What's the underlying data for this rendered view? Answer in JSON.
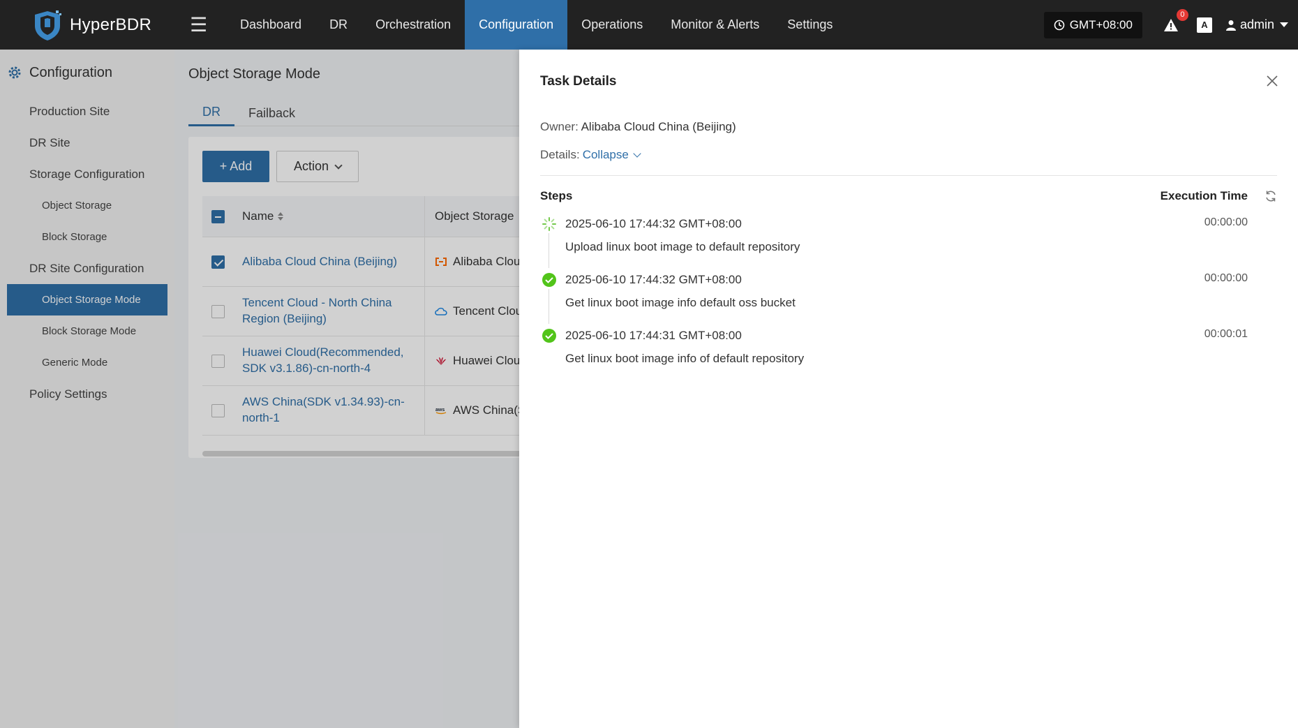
{
  "app": {
    "name": "HyperBDR"
  },
  "nav": {
    "items": [
      "Dashboard",
      "DR",
      "Orchestration",
      "Configuration",
      "Operations",
      "Monitor & Alerts",
      "Settings"
    ],
    "active": "Configuration"
  },
  "topbar": {
    "timezone": "GMT+08:00",
    "alert_count": "0",
    "lang_glyph": "A",
    "user": "admin"
  },
  "sidebar": {
    "title": "Configuration",
    "items": [
      {
        "label": "Production Site"
      },
      {
        "label": "DR Site"
      },
      {
        "label": "Storage Configuration"
      },
      {
        "label": "Object Storage"
      },
      {
        "label": "Block Storage"
      },
      {
        "label": "DR Site Configuration"
      },
      {
        "label": "Object Storage Mode"
      },
      {
        "label": "Block Storage Mode"
      },
      {
        "label": "Generic Mode"
      },
      {
        "label": "Policy Settings"
      }
    ]
  },
  "main": {
    "title": "Object Storage Mode",
    "tabs": [
      "DR",
      "Failback"
    ],
    "add_label": "+ Add",
    "action_label": "Action",
    "table": {
      "headers": {
        "name": "Name",
        "object_storage": "Object Storage"
      },
      "rows": [
        {
          "name": "Alibaba Cloud China (Beijing)",
          "storage": "Alibaba Cloud",
          "checked": true
        },
        {
          "name": "Tencent Cloud - North China Region (Beijing)",
          "storage": "Tencent Cloud",
          "checked": false
        },
        {
          "name": "Huawei Cloud(Recommended, SDK v3.1.86)-cn-north-4",
          "storage": "Huawei Cloud",
          "checked": false
        },
        {
          "name": "AWS China(SDK v1.34.93)-cn-north-1",
          "storage": "AWS China(S",
          "checked": false
        }
      ]
    }
  },
  "drawer": {
    "title": "Task Details",
    "owner_label": "Owner:",
    "owner_value": "Alibaba Cloud China (Beijing)",
    "details_label": "Details:",
    "collapse_label": "Collapse",
    "steps_label": "Steps",
    "exec_time_label": "Execution Time",
    "steps": [
      {
        "status": "running",
        "time": "2025-06-10 17:44:32 GMT+08:00",
        "desc": "Upload linux boot image to default repository",
        "duration": "00:00:00"
      },
      {
        "status": "success",
        "time": "2025-06-10 17:44:32 GMT+08:00",
        "desc": "Get linux boot image info default oss bucket",
        "duration": "00:00:00"
      },
      {
        "status": "success",
        "time": "2025-06-10 17:44:31 GMT+08:00",
        "desc": "Get linux boot image info of default repository",
        "duration": "00:00:01"
      }
    ]
  },
  "colors": {
    "accent": "#2f6fa8",
    "topbar": "#222222",
    "success": "#52c41a"
  }
}
